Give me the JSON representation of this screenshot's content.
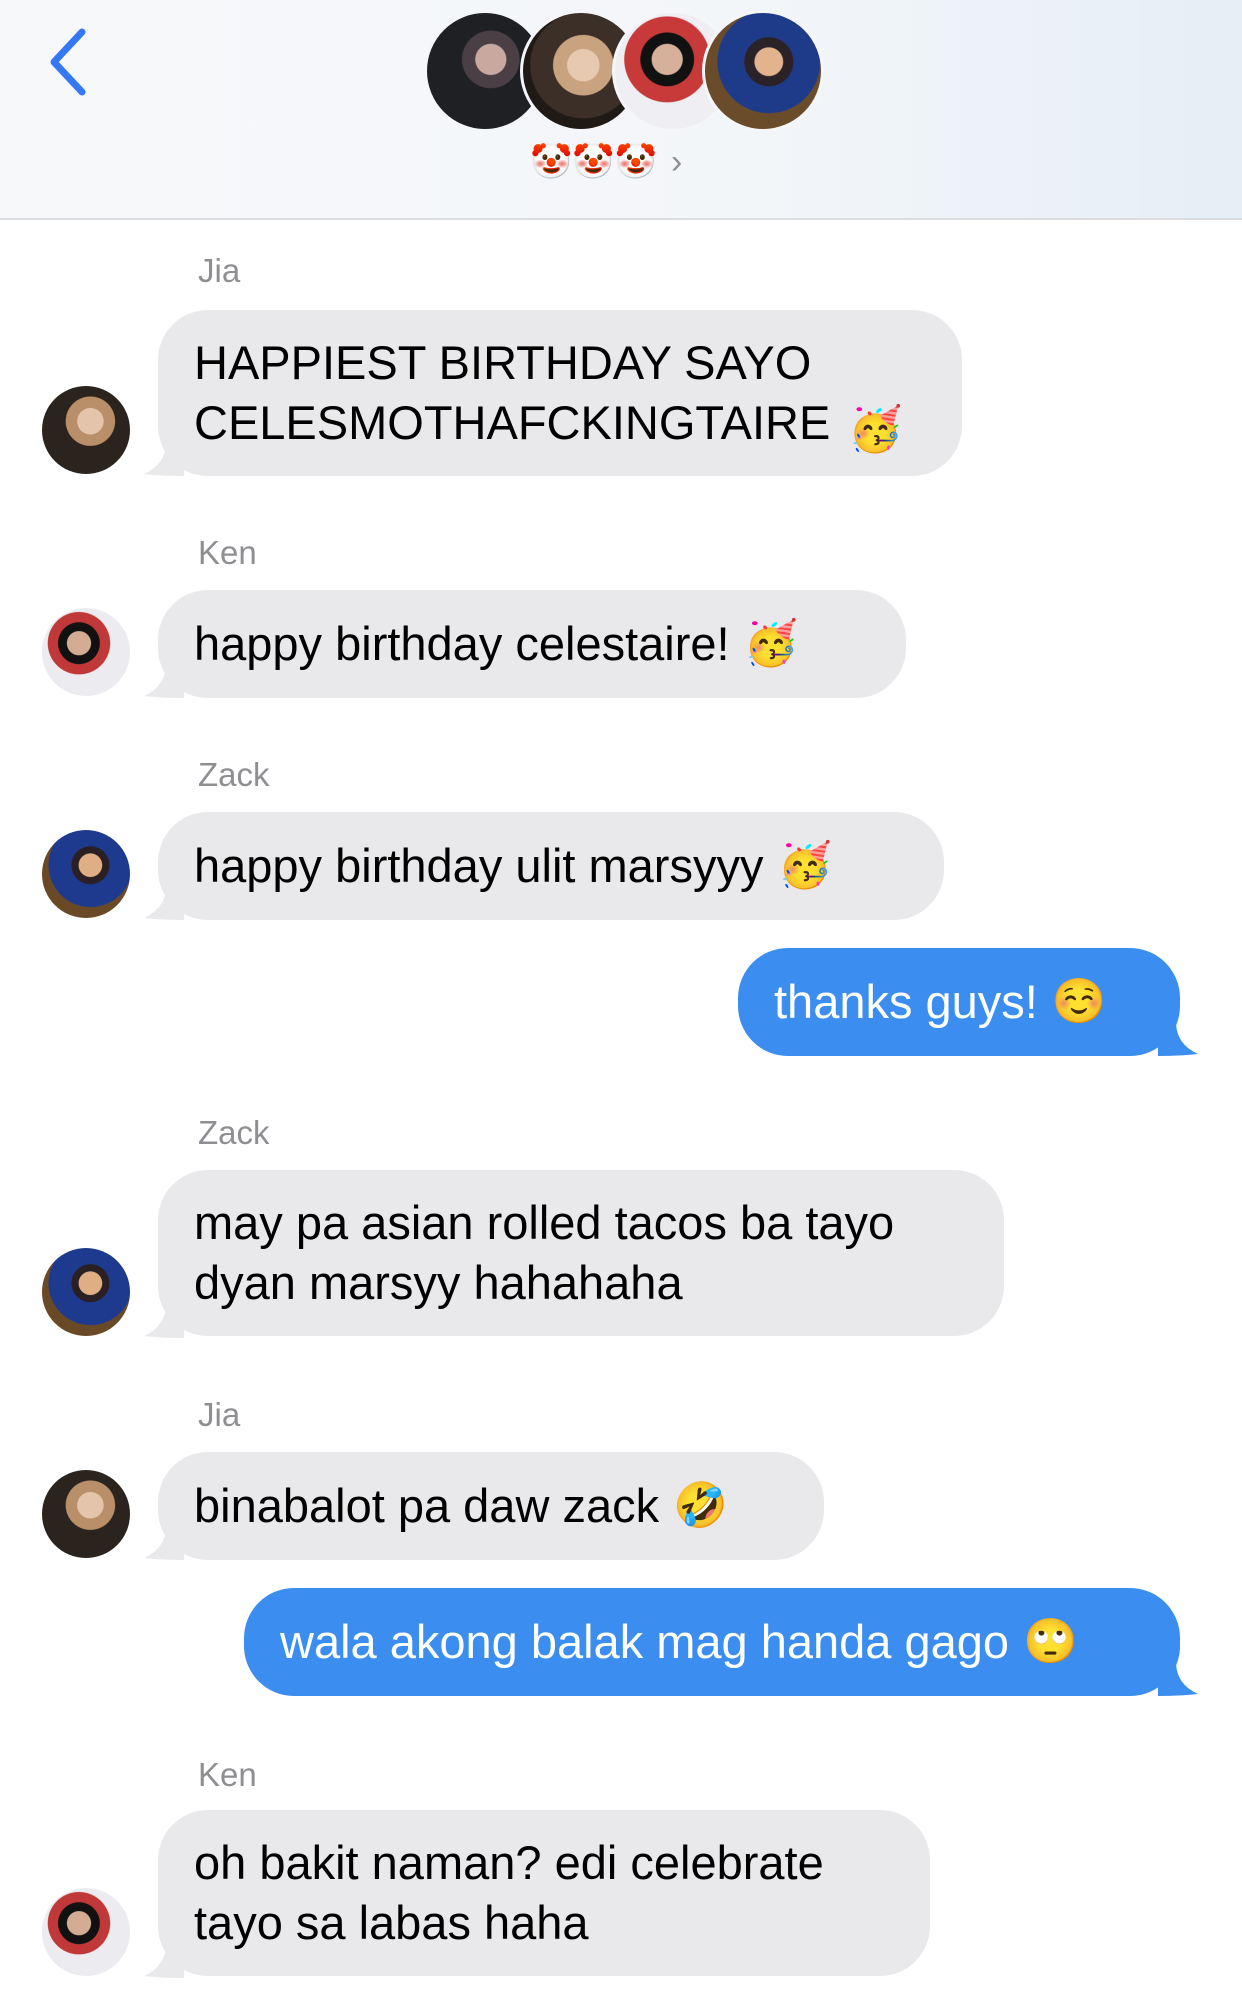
{
  "header": {
    "back_icon": "chevron-left-icon",
    "group_name": "🤡🤡🤡",
    "chevron": "›",
    "accent": "#3478f6"
  },
  "colors": {
    "incoming_bubble": "#e9e9eb",
    "outgoing_bubble": "#3b8ef0"
  },
  "messages": [
    {
      "sender": "Jia",
      "text": "HAPPIEST BIRTHDAY SAYO\nCELESMOTHAFCKINGTAIRE",
      "emoji": "🥳",
      "direction": "incoming"
    },
    {
      "sender": "Ken",
      "text": "happy birthday celestaire!",
      "emoji": "🥳",
      "direction": "incoming"
    },
    {
      "sender": "Zack",
      "text": "happy birthday ulit marsyyy",
      "emoji": "🥳",
      "direction": "incoming"
    },
    {
      "text": "thanks guys!",
      "emoji": "☺️",
      "direction": "outgoing"
    },
    {
      "sender": "Zack",
      "text": "may pa asian rolled tacos ba tayo\ndyan marsyy hahahaha",
      "direction": "incoming"
    },
    {
      "sender": "Jia",
      "text": "binabalot pa daw zack",
      "emoji": "🤣",
      "direction": "incoming"
    },
    {
      "text": "wala akong balak mag handa gago",
      "emoji": "🙄",
      "direction": "outgoing"
    },
    {
      "sender": "Ken",
      "text": "oh bakit naman? edi celebrate\ntayo sa labas haha",
      "direction": "incoming"
    }
  ]
}
